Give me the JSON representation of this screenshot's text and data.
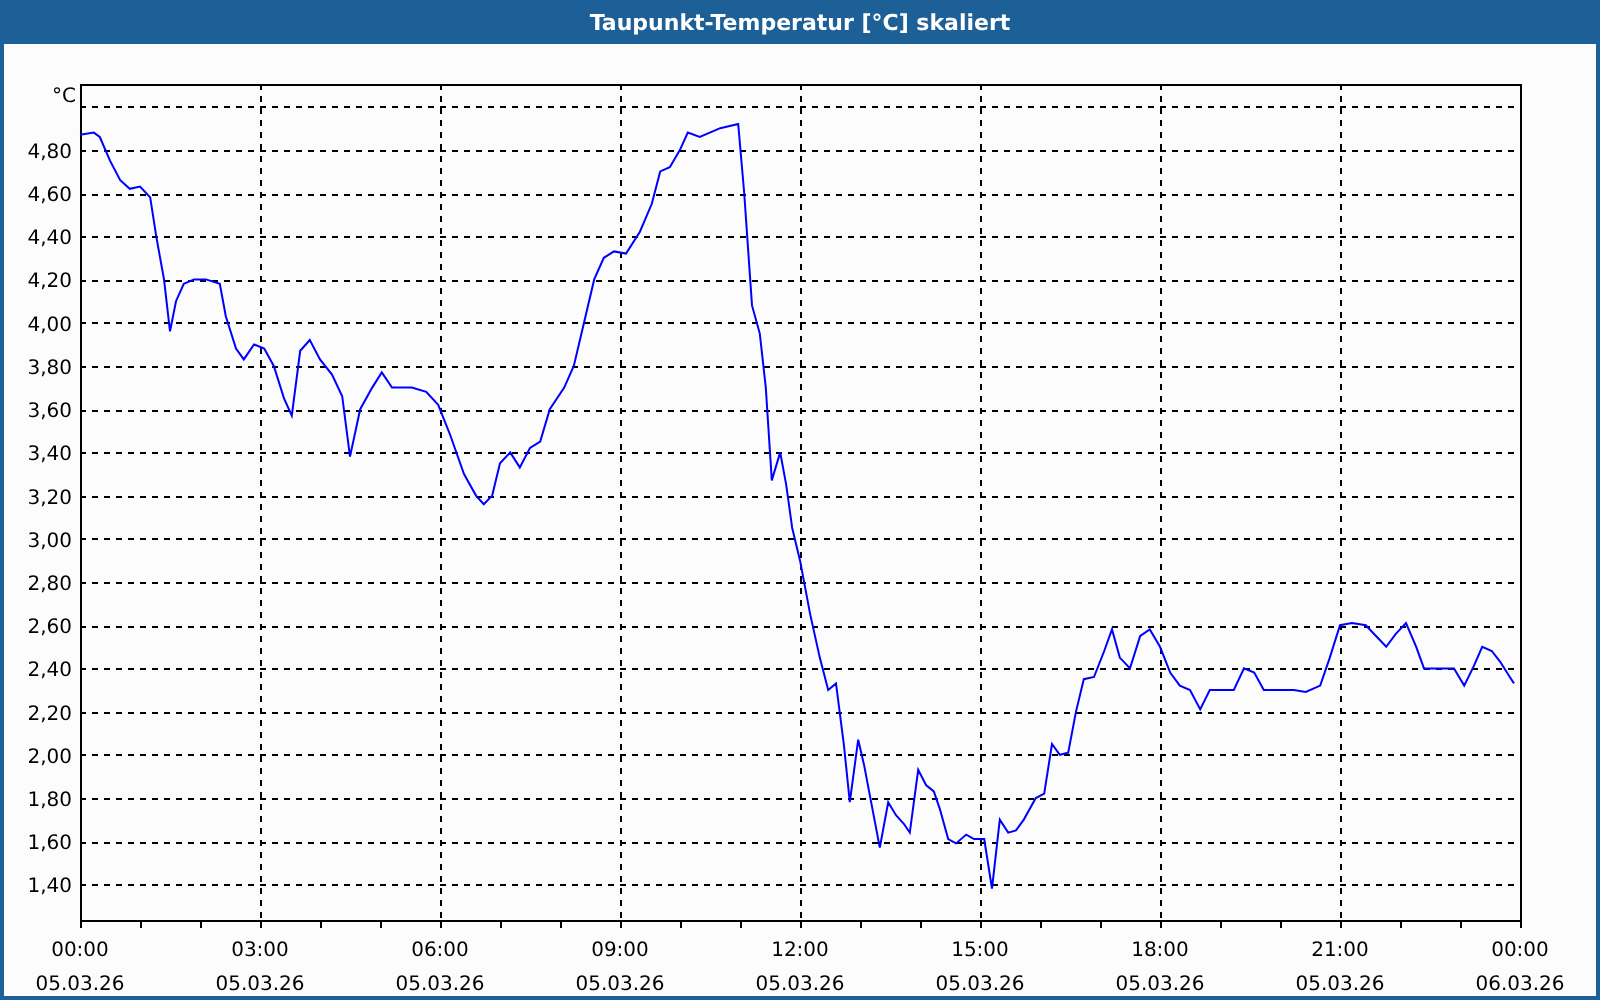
{
  "window": {
    "title": "Taupunkt-Temperatur [°C] skaliert"
  },
  "chart": {
    "date_labels": [
      "05.03.26",
      "05.03.26",
      "05.03.26",
      "05.03.26",
      "05.03.26",
      "05.03.26",
      "05.03.26",
      "05.03.26",
      "06.03.26"
    ],
    "chart_data": {
      "type": "line",
      "grid": true,
      "ylabel": "°C",
      "x": [
        0,
        0.23,
        0.33,
        0.5,
        0.67,
        0.83,
        1,
        1.17,
        1.27,
        1.4,
        1.5,
        1.6,
        1.73,
        1.9,
        2.1,
        2.33,
        2.43,
        2.6,
        2.73,
        2.9,
        3.07,
        3.23,
        3.4,
        3.53,
        3.67,
        3.83,
        4,
        4.2,
        4.37,
        4.5,
        4.67,
        4.87,
        5.03,
        5.2,
        5.53,
        5.77,
        5.97,
        6.17,
        6.4,
        6.6,
        6.73,
        6.87,
        7,
        7.17,
        7.33,
        7.5,
        7.67,
        7.83,
        8.07,
        8.23,
        8.4,
        8.57,
        8.73,
        8.9,
        9.1,
        9.33,
        9.53,
        9.67,
        9.83,
        10,
        10.13,
        10.33,
        10.67,
        10.97,
        11.07,
        11.2,
        11.33,
        11.43,
        11.53,
        11.67,
        11.77,
        11.87,
        12,
        12.17,
        12.33,
        12.47,
        12.6,
        12.73,
        12.83,
        12.97,
        13.07,
        13.2,
        13.33,
        13.47,
        13.6,
        13.73,
        13.83,
        13.97,
        14.1,
        14.23,
        14.33,
        14.47,
        14.6,
        14.77,
        14.9,
        15.07,
        15.2,
        15.33,
        15.47,
        15.6,
        15.73,
        15.93,
        16.07,
        16.2,
        16.33,
        16.47,
        16.6,
        16.73,
        16.9,
        17.07,
        17.2,
        17.33,
        17.5,
        17.67,
        17.83,
        18,
        18.17,
        18.33,
        18.5,
        18.67,
        18.83,
        19.07,
        19.23,
        19.4,
        19.57,
        19.73,
        20,
        20.23,
        20.43,
        20.67,
        20.83,
        21,
        21.2,
        21.43,
        21.6,
        21.77,
        21.93,
        22.1,
        22.27,
        22.4,
        22.6,
        22.73,
        22.9,
        23.07,
        23.23,
        23.37,
        23.53,
        23.67,
        23.83,
        23.9
      ],
      "values": [
        4.87,
        4.88,
        4.86,
        4.75,
        4.66,
        4.62,
        4.63,
        4.58,
        4.4,
        4.2,
        3.96,
        4.1,
        4.18,
        4.2,
        4.2,
        4.18,
        4.03,
        3.88,
        3.83,
        3.9,
        3.88,
        3.8,
        3.65,
        3.57,
        3.87,
        3.92,
        3.83,
        3.76,
        3.66,
        3.38,
        3.6,
        3.7,
        3.77,
        3.7,
        3.7,
        3.68,
        3.62,
        3.48,
        3.3,
        3.2,
        3.16,
        3.2,
        3.35,
        3.4,
        3.33,
        3.42,
        3.45,
        3.6,
        3.7,
        3.8,
        4,
        4.2,
        4.3,
        4.33,
        4.32,
        4.42,
        4.55,
        4.7,
        4.72,
        4.8,
        4.88,
        4.86,
        4.9,
        4.92,
        4.6,
        4.08,
        3.95,
        3.7,
        3.27,
        3.4,
        3.25,
        3.05,
        2.9,
        2.65,
        2.45,
        2.3,
        2.33,
        2.05,
        1.78,
        2.07,
        1.95,
        1.76,
        1.57,
        1.78,
        1.72,
        1.68,
        1.64,
        1.93,
        1.86,
        1.83,
        1.75,
        1.61,
        1.59,
        1.63,
        1.61,
        1.61,
        1.38,
        1.7,
        1.64,
        1.65,
        1.7,
        1.8,
        1.82,
        2.05,
        2,
        2.01,
        2.2,
        2.35,
        2.36,
        2.48,
        2.58,
        2.45,
        2.4,
        2.55,
        2.58,
        2.5,
        2.38,
        2.32,
        2.3,
        2.21,
        2.3,
        2.3,
        2.3,
        2.4,
        2.38,
        2.3,
        2.3,
        2.3,
        2.29,
        2.32,
        2.45,
        2.6,
        2.61,
        2.6,
        2.55,
        2.5,
        2.56,
        2.61,
        2.5,
        2.4,
        2.4,
        2.4,
        2.4,
        2.32,
        2.41,
        2.5,
        2.48,
        2.43,
        2.36,
        2.33
      ],
      "xlim": [
        0,
        24
      ],
      "ylim": [
        1.235,
        5.105
      ],
      "xticks": [
        {
          "value": 0,
          "label": "00:00"
        },
        {
          "value": 3,
          "label": "03:00"
        },
        {
          "value": 6,
          "label": "06:00"
        },
        {
          "value": 9,
          "label": "09:00"
        },
        {
          "value": 12,
          "label": "12:00"
        },
        {
          "value": 15,
          "label": "15:00"
        },
        {
          "value": 18,
          "label": "18:00"
        },
        {
          "value": 21,
          "label": "21:00"
        },
        {
          "value": 24,
          "label": "00:00"
        }
      ],
      "yticks": [
        {
          "value": 1.4,
          "label": "1,40"
        },
        {
          "value": 1.6,
          "label": "1,60"
        },
        {
          "value": 1.8,
          "label": "1,80"
        },
        {
          "value": 2.0,
          "label": "2,00"
        },
        {
          "value": 2.2,
          "label": "2,20"
        },
        {
          "value": 2.4,
          "label": "2,40"
        },
        {
          "value": 2.6,
          "label": "2,60"
        },
        {
          "value": 2.8,
          "label": "2,80"
        },
        {
          "value": 3.0,
          "label": "3,00"
        },
        {
          "value": 3.2,
          "label": "3,20"
        },
        {
          "value": 3.4,
          "label": "3,40"
        },
        {
          "value": 3.6,
          "label": "3,60"
        },
        {
          "value": 3.8,
          "label": "3,80"
        },
        {
          "value": 4.0,
          "label": "4,00"
        },
        {
          "value": 4.2,
          "label": "4,20"
        },
        {
          "value": 4.4,
          "label": "4,40"
        },
        {
          "value": 4.6,
          "label": "4,60"
        },
        {
          "value": 4.8,
          "label": "4,80"
        }
      ]
    }
  }
}
